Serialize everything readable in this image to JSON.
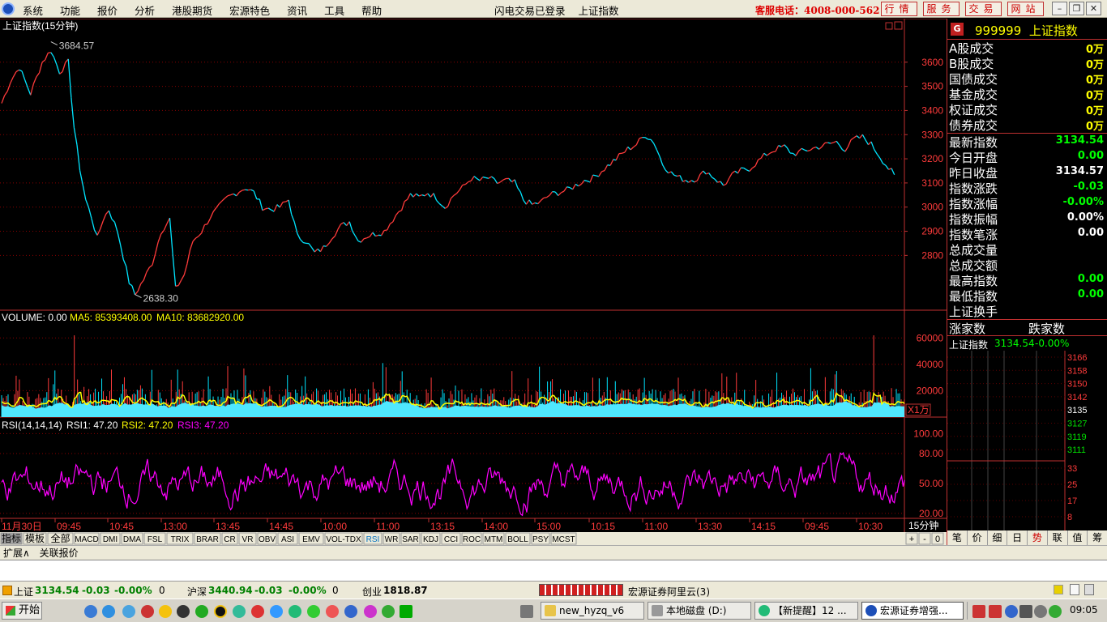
{
  "menubar": {
    "items": [
      "系统",
      "功能",
      "报价",
      "分析",
      "港股期货",
      "宏源特色",
      "资讯",
      "工具",
      "帮助"
    ],
    "status_login": "闪电交易已登录",
    "status_index": "上证指数",
    "hotline": "客服电话：4008-000-562",
    "tab_buttons": [
      "行情",
      "服务",
      "交易",
      "网站"
    ]
  },
  "chart_data": {
    "type": "line",
    "title": "上证指数(15分钟)",
    "main_ylim": [
      2600,
      3720
    ],
    "main_yticks": [
      "3600",
      "3500",
      "3400",
      "3300",
      "3200",
      "3100",
      "3000",
      "2900",
      "2800"
    ],
    "high_label": "3684.57",
    "low_label": "2638.30",
    "price_keypoints": [
      [
        0,
        3430
      ],
      [
        3,
        3520
      ],
      [
        6,
        3580
      ],
      [
        10,
        3470
      ],
      [
        14,
        3600
      ],
      [
        17,
        3650
      ],
      [
        20,
        3560
      ],
      [
        23,
        3600
      ],
      [
        25,
        3330
      ],
      [
        27,
        3160
      ],
      [
        29,
        3030
      ],
      [
        31,
        2960
      ],
      [
        33,
        2870
      ],
      [
        35,
        2950
      ],
      [
        37,
        2990
      ],
      [
        40,
        2900
      ],
      [
        44,
        2690
      ],
      [
        46,
        2638
      ],
      [
        49,
        2700
      ],
      [
        52,
        2770
      ],
      [
        55,
        2900
      ],
      [
        58,
        2950
      ],
      [
        60,
        2660
      ],
      [
        63,
        2720
      ],
      [
        66,
        2860
      ],
      [
        69,
        2900
      ],
      [
        72,
        2960
      ],
      [
        75,
        3000
      ],
      [
        78,
        3040
      ],
      [
        81,
        3060
      ],
      [
        84,
        3080
      ],
      [
        87,
        3060
      ],
      [
        90,
        3000
      ],
      [
        93,
        2990
      ],
      [
        96,
        3000
      ],
      [
        99,
        3030
      ],
      [
        102,
        2880
      ],
      [
        105,
        2860
      ],
      [
        108,
        2810
      ],
      [
        111,
        2830
      ],
      [
        114,
        2880
      ],
      [
        117,
        2920
      ],
      [
        120,
        2940
      ],
      [
        123,
        2860
      ],
      [
        126,
        2880
      ],
      [
        129,
        2890
      ],
      [
        132,
        2900
      ],
      [
        135,
        2950
      ],
      [
        138,
        3000
      ],
      [
        141,
        3050
      ],
      [
        144,
        3040
      ],
      [
        147,
        3060
      ],
      [
        150,
        3040
      ],
      [
        153,
        3000
      ],
      [
        156,
        3050
      ],
      [
        159,
        3080
      ],
      [
        162,
        3120
      ],
      [
        165,
        3110
      ],
      [
        168,
        3120
      ],
      [
        171,
        3100
      ],
      [
        174,
        3110
      ],
      [
        177,
        3100
      ],
      [
        180,
        3030
      ],
      [
        183,
        3010
      ],
      [
        186,
        3020
      ],
      [
        189,
        3050
      ],
      [
        192,
        3060
      ],
      [
        195,
        3070
      ],
      [
        198,
        3090
      ],
      [
        201,
        3110
      ],
      [
        204,
        3120
      ],
      [
        207,
        3150
      ],
      [
        210,
        3180
      ],
      [
        213,
        3210
      ],
      [
        216,
        3240
      ],
      [
        219,
        3260
      ],
      [
        222,
        3300
      ],
      [
        225,
        3270
      ],
      [
        228,
        3180
      ],
      [
        231,
        3140
      ],
      [
        234,
        3120
      ],
      [
        237,
        3110
      ],
      [
        240,
        3120
      ],
      [
        243,
        3150
      ],
      [
        246,
        3120
      ],
      [
        249,
        3090
      ],
      [
        252,
        3130
      ],
      [
        255,
        3150
      ],
      [
        258,
        3160
      ],
      [
        261,
        3190
      ],
      [
        264,
        3220
      ],
      [
        267,
        3240
      ],
      [
        270,
        3250
      ],
      [
        273,
        3220
      ],
      [
        276,
        3230
      ],
      [
        279,
        3240
      ],
      [
        282,
        3250
      ],
      [
        285,
        3260
      ],
      [
        288,
        3270
      ],
      [
        291,
        3240
      ],
      [
        294,
        3280
      ],
      [
        297,
        3290
      ],
      [
        300,
        3260
      ],
      [
        303,
        3210
      ],
      [
        306,
        3160
      ],
      [
        308,
        3134
      ]
    ],
    "volume_label": "VOLUME: 0.00",
    "ma5_label": "MA5: 85393408.00",
    "ma10_label": "MA10: 83682920.00",
    "volume_ylim": [
      0,
      70000
    ],
    "volume_yticks": [
      "60000",
      "40000",
      "20000"
    ],
    "volume_unit": "X1万",
    "rsi_label": "RSI(14,14,14)",
    "rsi1_label": "RSI1: 47.20",
    "rsi2_label": "RSI2: 47.20",
    "rsi3_label": "RSI3: 47.20",
    "rsi_ylim": [
      15,
      110
    ],
    "rsi_yticks": [
      "100.00",
      "80.00",
      "50.00",
      "20.00"
    ],
    "x_labels": [
      "11月30日",
      "09:45",
      "10:45",
      "13:00",
      "13:45",
      "14:45",
      "10:00",
      "11:00",
      "13:15",
      "14:00",
      "15:00",
      "10:15",
      "11:00",
      "13:30",
      "14:15",
      "09:45",
      "10:30"
    ],
    "period": "15分钟",
    "colors": {
      "price_up": "#ff3b3b",
      "price_down": "#00e5ff",
      "ma5": "#ffff00",
      "rsi": "#ff00ff",
      "grid": "#8a0000",
      "axis": "#c03030"
    }
  },
  "indicator_tabs": [
    "指标",
    "模板",
    "全部",
    "MACD",
    "DMI",
    "DMA",
    "FSL",
    "TRIX",
    "BRAR",
    "CR",
    "VR",
    "OBV",
    "ASI",
    "EMV",
    "VOL-TDX",
    "RSI",
    "WR",
    "SAR",
    "KDJ",
    "CCI",
    "ROC",
    "MTM",
    "BOLL",
    "PSY",
    "MCST"
  ],
  "right_panel": {
    "code": "999999",
    "name": "上证指数",
    "section1": [
      {
        "label": "A股成交",
        "value": "0万"
      },
      {
        "label": "B股成交",
        "value": "0万"
      },
      {
        "label": "国债成交",
        "value": "0万"
      },
      {
        "label": "基金成交",
        "value": "0万"
      },
      {
        "label": "权证成交",
        "value": "0万"
      },
      {
        "label": "债券成交",
        "value": "0万"
      }
    ],
    "section2": [
      {
        "label": "最新指数",
        "value": "3134.54",
        "color": "#00ff00"
      },
      {
        "label": "今日开盘",
        "value": "0.00",
        "color": "#00ff00"
      },
      {
        "label": "昨日收盘",
        "value": "3134.57",
        "color": "#ffffff"
      },
      {
        "label": "指数涨跌",
        "value": "-0.03",
        "color": "#00ff00"
      },
      {
        "label": "指数涨幅",
        "value": "-0.00%",
        "color": "#00ff00"
      },
      {
        "label": "指数振幅",
        "value": "0.00%",
        "color": "#ffffff"
      },
      {
        "label": "指数笔涨",
        "value": "0.00",
        "color": "#ffffff"
      },
      {
        "label": "总成交量",
        "value": "",
        "color": "#ffffff"
      },
      {
        "label": "总成交额",
        "value": "",
        "color": "#ffffff"
      },
      {
        "label": "最高指数",
        "value": "0.00",
        "color": "#00ff00"
      },
      {
        "label": "最低指数",
        "value": "0.00",
        "color": "#00ff00"
      },
      {
        "label": "上证换手",
        "value": "",
        "color": "#ffffff"
      }
    ],
    "up_label": "涨家数",
    "down_label": "跌家数",
    "mini_name": "上证指数",
    "mini_price": "3134.54",
    "mini_change": "-0.00%",
    "mini_yticks": [
      "3166",
      "3158",
      "3150",
      "3142",
      "3135",
      "3127",
      "3119",
      "3111",
      "33",
      "25",
      "17",
      "8"
    ],
    "bottom_tabs": [
      "笔",
      "价",
      "细",
      "日",
      "势",
      "联",
      "值",
      "筹"
    ]
  },
  "bottom_tabs": [
    "扩展∧",
    "关联报价"
  ],
  "chart_controls": [
    "+",
    "-",
    "0"
  ],
  "ticker": {
    "sh_label": "上证",
    "sh_value": "3134.54",
    "sh_change": "-0.03",
    "sh_pct": "-0.00%",
    "sh_vol": "0",
    "hs_label": "沪深",
    "hs_value": "3440.94",
    "hs_change": "-0.03",
    "hs_pct": "-0.00%",
    "hs_vol": "0",
    "cy_label": "创业",
    "cy_value": "1818.87",
    "broker": "宏源证券阿里云(3)"
  },
  "taskbar": {
    "start": "开始",
    "tasks": [
      "new_hyzq_v6",
      "本地磁盘 (D:)",
      "【新提醒】12 ...",
      "宏源证券增强..."
    ],
    "clock": "09:05"
  }
}
